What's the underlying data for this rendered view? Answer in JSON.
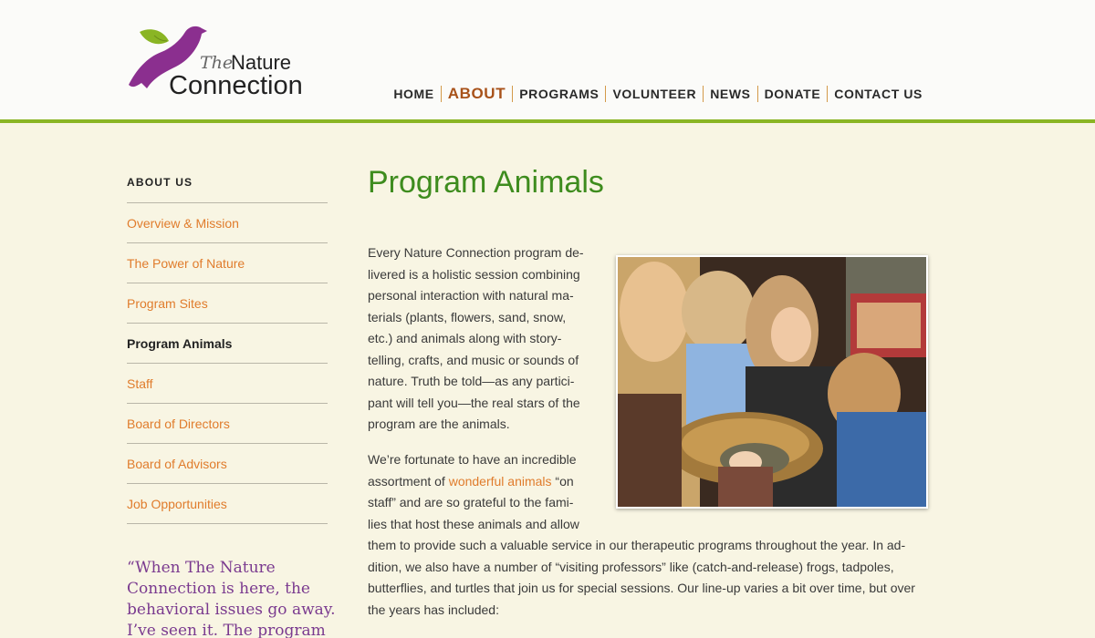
{
  "logo": {
    "the": "The",
    "nature": "Nature",
    "connection": "Connection"
  },
  "nav": {
    "items": [
      {
        "label": "HOME"
      },
      {
        "label": "ABOUT"
      },
      {
        "label": "PROGRAMS"
      },
      {
        "label": "VOLUNTEER"
      },
      {
        "label": "NEWS"
      },
      {
        "label": "DONATE"
      },
      {
        "label": "CONTACT US"
      }
    ]
  },
  "sidebar": {
    "title": "ABOUT US",
    "items": [
      {
        "label": "Overview & Mission"
      },
      {
        "label": "The Power of Nature"
      },
      {
        "label": "Program Sites"
      },
      {
        "label": "Program Animals"
      },
      {
        "label": "Staff"
      },
      {
        "label": "Board of Directors"
      },
      {
        "label": "Board of Advisors"
      },
      {
        "label": "Job Opportunities"
      }
    ]
  },
  "quote": "“When The Nature Connection is here, the behavioral issues go away. I’ve seen it. The program",
  "main": {
    "title": "Program Animals",
    "p1_lines": [
      "Every Nature Connection program de-",
      "livered is a holistic session combining",
      "personal interaction with natural ma-",
      "terials (plants, flowers, sand, snow,",
      "etc.) and animals along with story-",
      "telling, crafts, and music or sounds of",
      "nature. Truth be told—as any partici-",
      "pant will tell you—the real stars of the",
      "program are the animals."
    ],
    "p2_l1": "We’re fortunate to have an incredible",
    "p2_l2_pre": "assortment of ",
    "p2_link": "wonderful animals",
    "p2_l2_post": " “on",
    "p2_lines_rest": [
      "staff” and are so grateful to the fami-",
      "lies that host these animals and allow",
      "them to provide such a valuable service in our therapeutic programs throughout the year. In ad-",
      "dition, we also have a number of “visiting professors” like (catch-and-release) frogs, tadpoles,",
      "butterflies, and turtles that join us for special sessions. Our line-up varies a bit over time, but over",
      "the years has included:"
    ]
  },
  "colors": {
    "accent_green": "#8ab524",
    "title_green": "#3e8c1e",
    "link_orange": "#e07c2c",
    "active_nav": "#a8521a",
    "quote_purple": "#7a3a8f"
  }
}
